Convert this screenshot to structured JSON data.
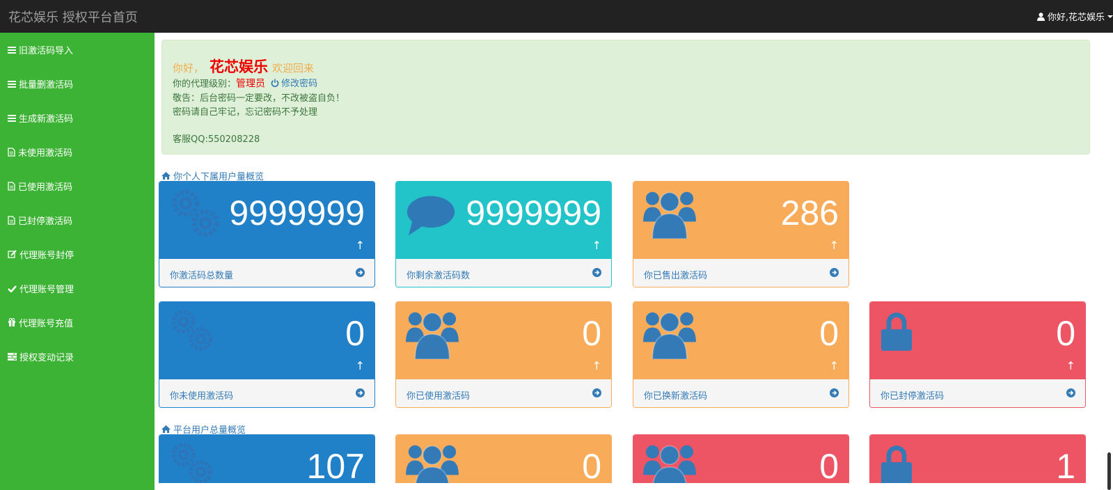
{
  "navbar": {
    "brand": "花芯娱乐 授权平台首页",
    "user_label": "你好,花芯娱乐"
  },
  "sidebar": {
    "items": [
      {
        "label": "旧激活码导入",
        "icon": "list-icon"
      },
      {
        "label": "批量删激活码",
        "icon": "list-icon"
      },
      {
        "label": "生成新激活码",
        "icon": "list-icon"
      },
      {
        "label": "未使用激活码",
        "icon": "file-icon"
      },
      {
        "label": "已使用激活码",
        "icon": "file-icon"
      },
      {
        "label": "已封停激活码",
        "icon": "file-icon"
      },
      {
        "label": "代理账号封停",
        "icon": "edit-icon"
      },
      {
        "label": "代理账号管理",
        "icon": "check-icon"
      },
      {
        "label": "代理账号充值",
        "icon": "gift-icon"
      },
      {
        "label": "授权变动记录",
        "icon": "tasks-icon"
      }
    ]
  },
  "welcome": {
    "hello": "你好，",
    "name": "花芯娱乐",
    "welcome_back": "欢迎回来",
    "level_label": "你的代理级别：",
    "level_value": "管理员",
    "change_password": "修改密码",
    "warning": "敬告：后台密码一定要改，不改被盗自负！",
    "remember": "密码请自己牢记，忘记密码不予处理",
    "support": "客服QQ:550208228"
  },
  "section_personal": "你个人下属用户量概览",
  "section_platform": "平台用户总量概览",
  "personal_panels": [
    {
      "value": "9999999",
      "label": "你激活码总数量",
      "color": "#2080c8",
      "icon": "gears-icon"
    },
    {
      "value": "9999999",
      "label": "你剩余激活码数",
      "color": "#22c3c9",
      "icon": "comment-icon"
    },
    {
      "value": "286",
      "label": "你已售出激活码",
      "color": "#f8ac59",
      "icon": "users-icon"
    },
    {
      "value": "0",
      "label": "你未使用激活码",
      "color": "#2080c8",
      "icon": "gears-icon"
    },
    {
      "value": "0",
      "label": "你已使用激活码",
      "color": "#f8ac59",
      "icon": "users-icon"
    },
    {
      "value": "0",
      "label": "你已换新激活码",
      "color": "#f8ac59",
      "icon": "users-icon"
    },
    {
      "value": "0",
      "label": "你已封停激活码",
      "color": "#ed5565",
      "icon": "lock-icon"
    }
  ],
  "platform_panels": [
    {
      "value": "107",
      "color": "#2080c8",
      "icon": "gears-icon"
    },
    {
      "value": "0",
      "color": "#f8ac59",
      "icon": "users-icon"
    },
    {
      "value": "0",
      "color": "#ed5565",
      "icon": "users-icon"
    },
    {
      "value": "1",
      "color": "#ed5565",
      "icon": "lock-icon"
    }
  ],
  "panel_arrow": "↑"
}
